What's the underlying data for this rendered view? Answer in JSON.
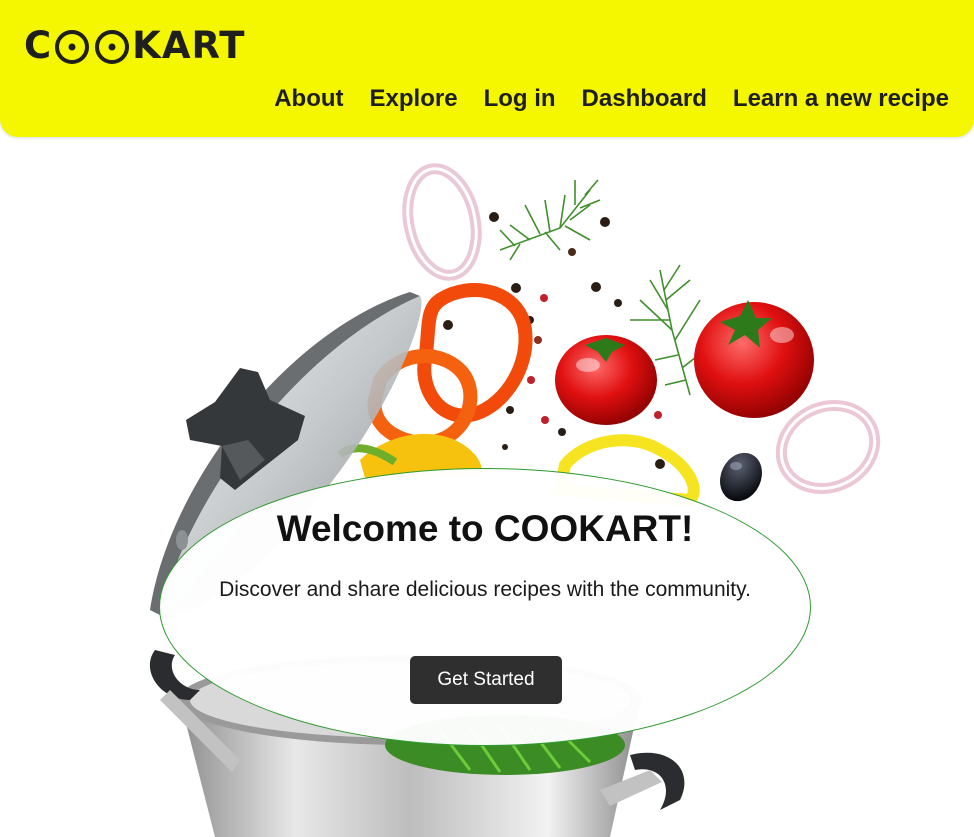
{
  "app": {
    "logo": {
      "prefix": "C",
      "suffix": "KART",
      "icon": "pot-eyes-icon"
    },
    "brand_color": "#f4f700"
  },
  "nav": {
    "items": [
      {
        "label": "About"
      },
      {
        "label": "Explore"
      },
      {
        "label": "Log in"
      },
      {
        "label": "Dashboard"
      },
      {
        "label": "Learn a new recipe"
      }
    ]
  },
  "hero": {
    "title": "Welcome to COOKART!",
    "subtitle": "Discover and share delicious recipes with the community.",
    "cta_label": "Get Started",
    "illustration": "cooking-pot-vegetables-illustration",
    "accent_color": "#2e9a2e",
    "button_color": "#2f2f2f"
  }
}
